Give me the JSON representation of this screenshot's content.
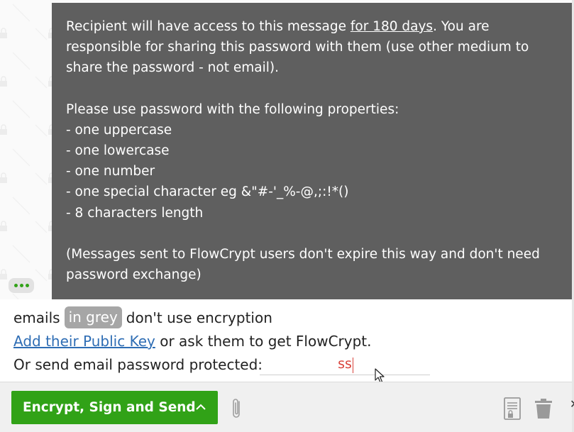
{
  "tooltip": {
    "line1_pre": "Recipient will have access to this message ",
    "line1_link": "for 180 days",
    "line1_post": ". You are responsible for sharing this password with them (use other medium to share the password - not email).",
    "properties_intro": "Please use password with the following properties:",
    "properties": [
      "- one uppercase",
      "- one lowercase",
      "- one number",
      "- one special character eg &\"#-'_%-@,;:!*()",
      "- 8 characters length"
    ],
    "footnote": "(Messages sent to FlowCrypt users don't expire this way and don't need password exchange)"
  },
  "warning": {
    "emails_label": "emails",
    "grey_pill": "in grey",
    "no_encryption": "don't use encryption",
    "add_key_link": "Add their Public Key",
    "ask_text": " or ask them to get FlowCrypt.",
    "password_prompt": "Or send email password protected:",
    "password_value": "ss"
  },
  "footer": {
    "send_label": "Encrypt, Sign and Send"
  },
  "colors": {
    "accent_green": "#31a217",
    "link_blue": "#2e6db4",
    "password_red": "#d9433b",
    "tooltip_bg": "#585858"
  },
  "icons": [
    "ellipsis-icon",
    "chevron-up-icon",
    "paperclip-icon",
    "document-lock-icon",
    "trash-icon",
    "mouse-pointer-icon"
  ]
}
